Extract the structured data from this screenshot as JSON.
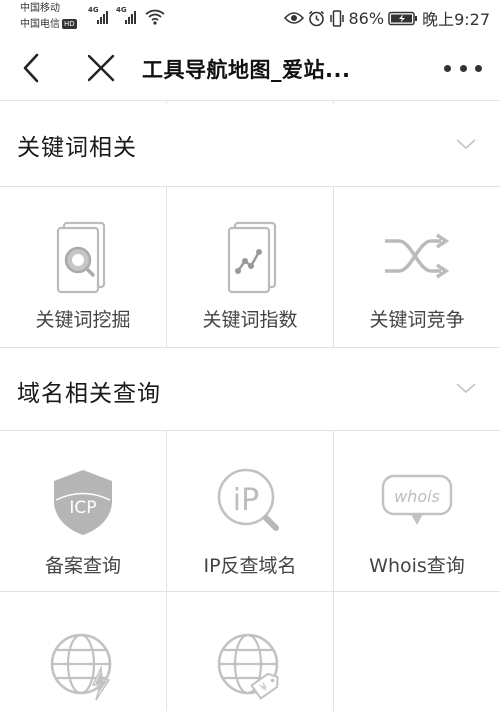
{
  "status_bar": {
    "carrier1": "中国移动",
    "carrier2": "中国电信",
    "hd_badge": "HD",
    "network1": "4G",
    "network2": "4G",
    "battery_percent": "86%",
    "time": "晚上9:27"
  },
  "title_bar": {
    "title": "工具导航地图_爱站..."
  },
  "sections": [
    {
      "title": "关键词相关",
      "tools": [
        {
          "label": "关键词挖掘",
          "icon": "document-search-icon"
        },
        {
          "label": "关键词指数",
          "icon": "trend-chart-icon"
        },
        {
          "label": "关键词竞争",
          "icon": "shuffle-icon"
        }
      ]
    },
    {
      "title": "域名相关查询",
      "tools": [
        {
          "label": "备案查询",
          "icon": "icp-shield-icon",
          "icon_text": "ICP"
        },
        {
          "label": "IP反查域名",
          "icon": "ip-search-icon",
          "icon_text": "iP"
        },
        {
          "label": "Whois查询",
          "icon": "whois-bubble-icon",
          "icon_text": "whois"
        }
      ]
    }
  ],
  "partial_row": {
    "icons": [
      "globe-lightning-icon",
      "globe-price-tag-icon"
    ],
    "tag_symbol": "¥"
  },
  "colors": {
    "icon_gray": "#b5b5b5",
    "divider": "#e2e2e2",
    "text_dark": "#1a1a1a",
    "label_gray": "#444444"
  }
}
